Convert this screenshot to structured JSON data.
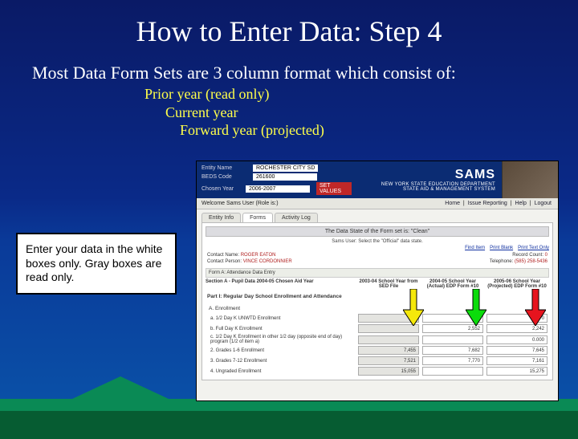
{
  "title": "How to Enter Data:  Step 4",
  "subtitle": "Most Data Form Sets are 3 column format which consist of:",
  "bullets": {
    "b1": "Prior year  (read only)",
    "b2": "Current year",
    "b3": "Forward year  (projected)"
  },
  "callout": "Enter your data in the white boxes only.  Gray boxes are read only.",
  "banner": {
    "row1_label": "Entity Name",
    "row1_value": "ROCHESTER CITY SD",
    "row2_label": "BEDS Code",
    "row2_value": "261600",
    "row3_label": "Chosen Year",
    "row3_value": "2006-2007",
    "setvalues": "SET VALUES",
    "sams": "SAMS",
    "dept1": "NEW YORK STATE EDUCATION DEPARTMENT",
    "dept2": "STATE AID & MANAGEMENT SYSTEM"
  },
  "welcome": {
    "left": "Welcome Sams User (Role is:)",
    "right_home": "Home",
    "right_issue": "Issue Reporting",
    "right_help": "Help",
    "right_logout": "Logout"
  },
  "tabs": {
    "t1": "Entity Info",
    "t2": "Forms",
    "t3": "Activity Log"
  },
  "form": {
    "title": "The Data State of the Form set is: \"Clean\"",
    "hint": "Sams User: Select the \"Official\" data state.",
    "link1": "Find Item",
    "link2": "Print Blank",
    "link3": "Print Text Only",
    "contact_name_label": "Contact Name",
    "contact_name_value": "ROGER EATON",
    "record_count_label": "Record Count",
    "record_count_value": "0",
    "contact_person_label": "Contact Person",
    "contact_person_value": "VINCE CORDONNIER",
    "telephone_label": "Telephone",
    "telephone_value": "(585) 258-5436",
    "section_head": "Form A: Attendance Data Entry",
    "note": "Section A - Pupil Data 2004-05 Chosen Aid Year",
    "col1": "2003-04 School Year from SED File",
    "col2": "2004-05 School Year (Actual) EDP Form #10",
    "col3": "2005-06 School Year (Projected) EDP Form #10",
    "part1": "Part I: Regular Day School Enrollment and Attendance",
    "groupA": "A. Enrollment",
    "rows": [
      {
        "label": "a. 1/2 Day K UNWTD Enrollment",
        "c1": "",
        "c2": "0",
        "c3": "0"
      },
      {
        "label": "b. Full Day K Enrollment",
        "c1": "",
        "c2": "2,552",
        "c3": "2,242"
      },
      {
        "label": "c. 1/2 Day K Enrollment in other 1/2 day (opposite end of day) program (1/2 of item a)",
        "c1": "",
        "c2": "",
        "c3": "0.000"
      },
      {
        "label": "2. Grades 1-6 Enrollment",
        "c1": "7,455",
        "c2": "7,682",
        "c3": "7,645"
      },
      {
        "label": "3. Grades 7-12 Enrollment",
        "c1": "7,521",
        "c2": "7,770",
        "c3": "7,161"
      },
      {
        "label": "4. Ungraded Enrollment",
        "c1": "15,055",
        "c2": "",
        "c3": "15,275"
      }
    ]
  }
}
